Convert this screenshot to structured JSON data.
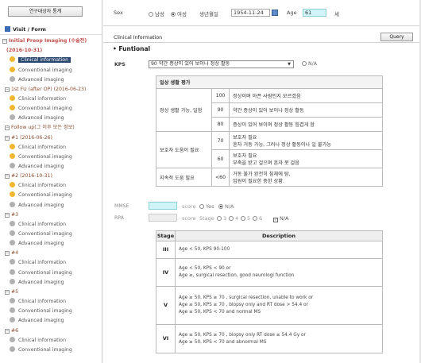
{
  "sidebar": {
    "stats_button": "연구대상자 통계",
    "heading": "Visit / Form",
    "items": [
      {
        "kind": "topic",
        "expander": "⊟",
        "label": "Initial Preop Imaging (수술전)"
      },
      {
        "kind": "topic-cont",
        "label": "(2016-10-31)"
      },
      {
        "kind": "child",
        "status": "done",
        "label": "Clinical information",
        "selected": true
      },
      {
        "kind": "child",
        "status": "done",
        "label": "Conventional imaging"
      },
      {
        "kind": "child",
        "status": "none",
        "label": "Advanced imaging"
      },
      {
        "kind": "node",
        "expander": "⊟",
        "label": "1st FU (after OP) (2016-06-23)"
      },
      {
        "kind": "child",
        "status": "done",
        "label": "Clinical information"
      },
      {
        "kind": "child",
        "status": "done",
        "label": "Conventional imaging"
      },
      {
        "kind": "child",
        "status": "none",
        "label": "Advanced imaging"
      },
      {
        "kind": "node",
        "expander": "⊟",
        "label": "Follow up(그 이후 모든 정보)"
      },
      {
        "kind": "node",
        "expander": "⊟",
        "label": "#1 (2016-06-26)"
      },
      {
        "kind": "child",
        "status": "done",
        "label": "Clinical information"
      },
      {
        "kind": "child",
        "status": "done",
        "label": "Conventional imaging"
      },
      {
        "kind": "child",
        "status": "none",
        "label": "Advanced imaging"
      },
      {
        "kind": "node",
        "expander": "⊟",
        "label": "#2 (2016-10-31)"
      },
      {
        "kind": "child",
        "status": "done",
        "label": "Clinical information"
      },
      {
        "kind": "child",
        "status": "done",
        "label": "Conventional imaging"
      },
      {
        "kind": "child",
        "status": "none",
        "label": "Advanced imaging"
      },
      {
        "kind": "node",
        "expander": "⊟",
        "label": "#3"
      },
      {
        "kind": "child",
        "status": "none",
        "label": "Clinical information"
      },
      {
        "kind": "child",
        "status": "none",
        "label": "Conventional imaging"
      },
      {
        "kind": "child",
        "status": "none",
        "label": "Advanced imaging"
      },
      {
        "kind": "node",
        "expander": "⊟",
        "label": "#4"
      },
      {
        "kind": "child",
        "status": "none",
        "label": "Clinical information"
      },
      {
        "kind": "child",
        "status": "none",
        "label": "Conventional imaging"
      },
      {
        "kind": "child",
        "status": "none",
        "label": "Advanced imaging"
      },
      {
        "kind": "node",
        "expander": "⊟",
        "label": "#5"
      },
      {
        "kind": "child",
        "status": "none",
        "label": "Clinical information"
      },
      {
        "kind": "child",
        "status": "none",
        "label": "Conventional imaging"
      },
      {
        "kind": "child",
        "status": "none",
        "label": "Advanced imaging"
      },
      {
        "kind": "node",
        "expander": "⊟",
        "label": "#6"
      },
      {
        "kind": "child",
        "status": "none",
        "label": "Clinical information"
      },
      {
        "kind": "child",
        "status": "none",
        "label": "Conventional imaging"
      }
    ]
  },
  "patient": {
    "sex_label": "Sex",
    "male_label": "남성",
    "female_label": "여성",
    "selected_sex": "여성",
    "birth_label": "생년월일",
    "birth_value": "1954-11-24",
    "age_label": "Age",
    "age_value": "61",
    "age_unit": "세"
  },
  "clinical": {
    "section_title": "Clinical Information",
    "query_button": "Query",
    "functional_title": "• Funtional",
    "kps_label": "KPS",
    "kps_selected": "90 약간 증상이 있어 보이나 정상 활동",
    "kps_na_label": "N/A",
    "kps_table": {
      "header": "일상 생활 평가",
      "rows": [
        {
          "category": "정상 생활 가능, 일함",
          "score": "100",
          "desc": "정상이며 아픈 사람인지 모르겠음"
        },
        {
          "category": "",
          "score": "90",
          "desc": "약간 증상이 있어 보이나 정상 활동"
        },
        {
          "category": "",
          "score": "80",
          "desc": "증상이 있어 보이며 정상 활동 힘겹게 함"
        },
        {
          "category": "보호자 도움이 필요",
          "score": "70",
          "desc": "보호자 필요\n혼자 거동 가능, 그러나 정상 활동이나 일 불가능"
        },
        {
          "category": "",
          "score": "60",
          "desc": "보호자 필요\n부축을 받고 걸으며 혼자 못 걸음"
        },
        {
          "category": "지속적 도움 필요",
          "score": "<60",
          "desc": "거동 불가 완전히 침체에 탐,\n입원이 필요한 중한 상황."
        }
      ]
    },
    "mmse": {
      "label": "MMSE",
      "value": "",
      "score_label": "score",
      "yes_label": "Yes",
      "na_label": "N/A",
      "selected": "N/A"
    },
    "rpa": {
      "label": "RPA",
      "value": "",
      "score_label": "score",
      "stage_label": "Stage",
      "stages": [
        "3",
        "4",
        "5",
        "6"
      ],
      "na_label": "N/A",
      "na_checked": true
    },
    "stage_table": {
      "headers": [
        "Stage",
        "Description"
      ],
      "rows": [
        {
          "stage": "III",
          "lines": [
            "Age < 50, KPS 90-100"
          ]
        },
        {
          "stage": "IV",
          "lines": [
            "Age < 50, KPS < 90 or",
            "Age ≥, surgical resection, good neurologi function"
          ]
        },
        {
          "stage": "V",
          "lines": [
            "Age ≥ 50, KPS ≥ 70 , surgical resection, unable to work or",
            "Age ≥ 50, KPS ≥ 70 , biopsy only and RT dose > 54.4 or",
            "Age ≥ 50, KPS < 70 and normal MS"
          ]
        },
        {
          "stage": "VI",
          "lines": [
            "Age ≥ 50, KPS ≥ 70 , biopsy only RT dose ≤ 54.4 Gy or",
            "Age ≥ 50, KPS < 70 and abnormal MS"
          ]
        }
      ]
    }
  }
}
